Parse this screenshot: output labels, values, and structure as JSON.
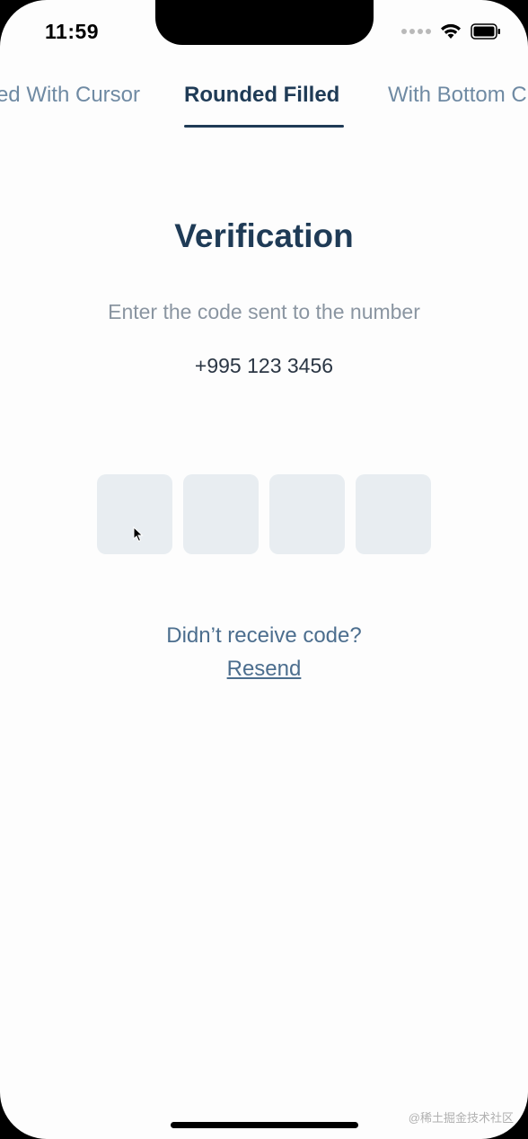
{
  "status_bar": {
    "time": "11:59"
  },
  "tabs": [
    {
      "label": "Filled With Cursor",
      "active": false
    },
    {
      "label": "Rounded Filled",
      "active": true
    },
    {
      "label": "With Bottom Cursor",
      "active": false
    }
  ],
  "verification": {
    "title": "Verification",
    "subtitle": "Enter the code sent to the number",
    "phone_number": "+995 123 3456",
    "code_digits": [
      "",
      "",
      "",
      ""
    ]
  },
  "resend": {
    "question": "Didn’t receive code?",
    "link_label": "Resend"
  },
  "watermark": "@稀土掘金技术社区",
  "colors": {
    "primary": "#1f3b56",
    "inactive_tab": "#6f8aa3",
    "box_fill": "#e8edf1",
    "link": "#4c6e8e"
  }
}
